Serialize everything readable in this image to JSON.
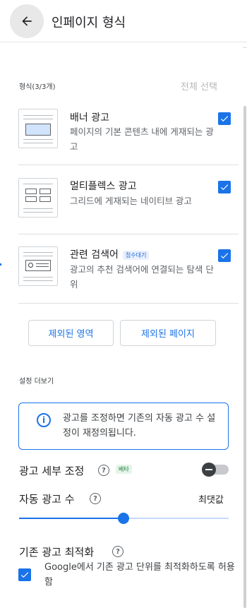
{
  "header": {
    "title": "인페이지 형식",
    "back_icon": "arrow-left-icon"
  },
  "formats": {
    "section_label": "형식(3/3개)",
    "select_all_label": "전체 선택",
    "items": [
      {
        "title": "배너 광고",
        "description": "페이지의 기본 콘텐츠 내에 게재되는 광고",
        "checked": true,
        "thumb_icon": "banner-ad-icon"
      },
      {
        "title": "멀티플렉스 광고",
        "description": "그리드에 게재되는 네이티브 광고",
        "checked": true,
        "thumb_icon": "multiplex-ad-icon"
      },
      {
        "title": "관련 검색어",
        "badge": "접수대기",
        "description": "광고의 추천 검색어에 연결되는 탐색 단위",
        "checked": true,
        "thumb_icon": "related-search-icon"
      }
    ]
  },
  "buttons": {
    "excluded_areas": "제외된 영역",
    "excluded_pages": "제외된 페이지"
  },
  "more_settings": {
    "label": "설정 더보기",
    "info_text": "광고를 조정하면 기존의 자동 광고 수 설정이 재정의됩니다.",
    "ad_fine_tuning": {
      "label": "광고 세부 조정",
      "badge": "베타",
      "enabled": false
    },
    "auto_ad_count": {
      "label": "자동 광고 수",
      "value_label": "최댓값",
      "slider_fraction": 0.5
    },
    "existing_ad_optimization": {
      "label": "기존 광고 최적화",
      "option_text": "Google에서 기존 광고 단위를 최적화하도록 허용함",
      "checked": true
    }
  },
  "colors": {
    "accent": "#1a73e8",
    "beta": "#188038"
  }
}
